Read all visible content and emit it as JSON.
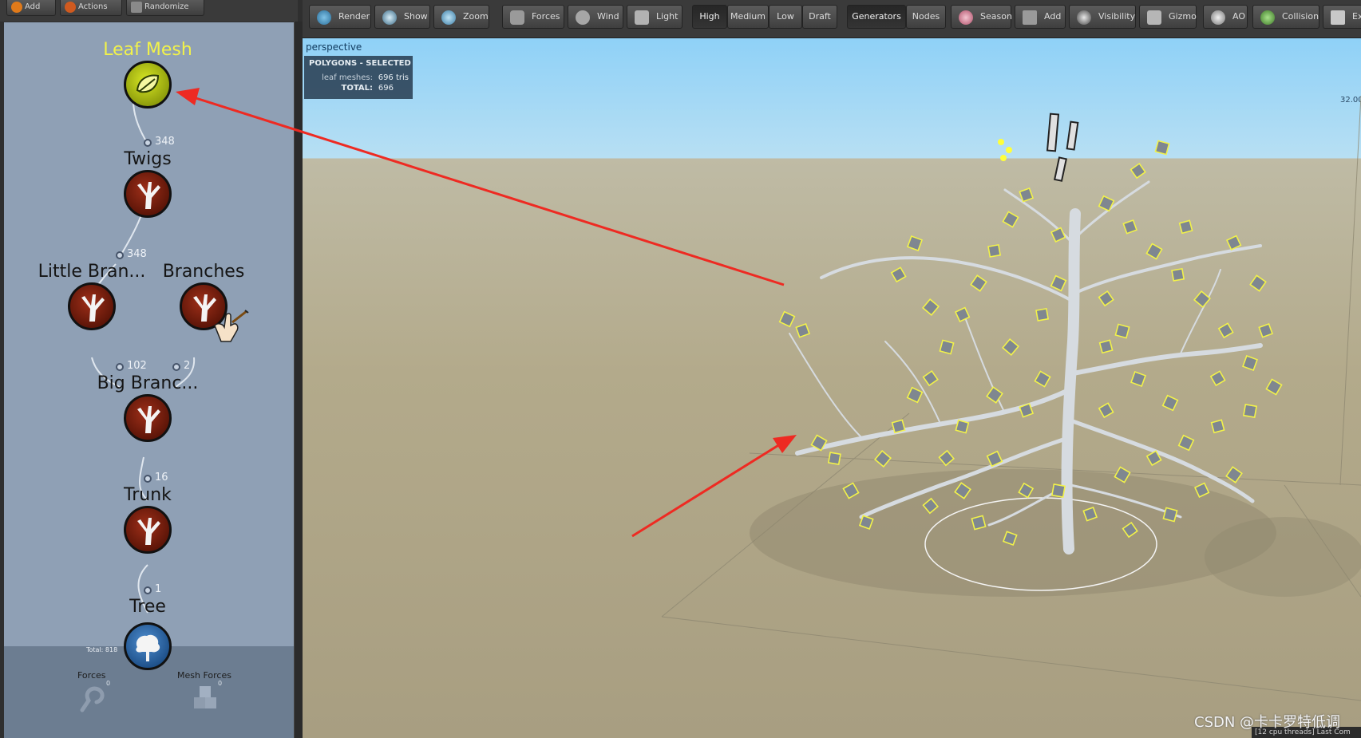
{
  "left_toolbar": {
    "add_label": "Add",
    "actions_label": "Actions",
    "randomize_label": "Randomize"
  },
  "node_graph": {
    "nodes": [
      {
        "label": "Leaf Mesh",
        "kind": "leaf",
        "selected": true
      },
      {
        "label": "Twigs",
        "kind": "branch"
      },
      {
        "label": "Little Bran...",
        "kind": "branch"
      },
      {
        "label": "Branches",
        "kind": "branch"
      },
      {
        "label": "Big Branc...",
        "kind": "branch"
      },
      {
        "label": "Trunk",
        "kind": "branch"
      },
      {
        "label": "Tree",
        "kind": "tree"
      }
    ],
    "counts": {
      "leaf_to_twigs": "348",
      "twigs_to_little": "348",
      "little_to_big": "102",
      "branches_to_big": "2",
      "big_to_trunk": "16",
      "trunk_to_tree": "1"
    },
    "total_label": "Total: 818",
    "forces_label": "Forces",
    "forces_count": "0",
    "mesh_forces_label": "Mesh Forces",
    "mesh_forces_count": "0"
  },
  "toolbar": {
    "render": "Render",
    "show": "Show",
    "zoom": "Zoom",
    "forces": "Forces",
    "wind": "Wind",
    "light": "Light",
    "quality": [
      "High",
      "Medium",
      "Low",
      "Draft"
    ],
    "quality_selected": "High",
    "generators": "Generators",
    "nodes": "Nodes",
    "season": "Season",
    "add": "Add",
    "visibility": "Visibility",
    "gizmo": "Gizmo",
    "ao": "AO",
    "collision": "Collision",
    "export_partial": "Ex"
  },
  "viewport": {
    "camera_label": "perspective",
    "stats": {
      "header": "POLYGONS - SELECTED",
      "leaf_meshes_label": "leaf meshes:",
      "leaf_meshes_value": "696 tris",
      "total_label": "TOTAL:",
      "total_value": "696"
    },
    "grid_value": "32.00",
    "status_text": "[12 cpu threads]  Last Com"
  },
  "colors": {
    "panel_bg": "#8fa0b5",
    "selection_yellow": "#f2f24a",
    "arrow_red": "#ee2a22",
    "sky": "#8fd1f7",
    "ground": "#b3aa8b"
  },
  "watermark": "CSDN @卡卡罗特低调"
}
